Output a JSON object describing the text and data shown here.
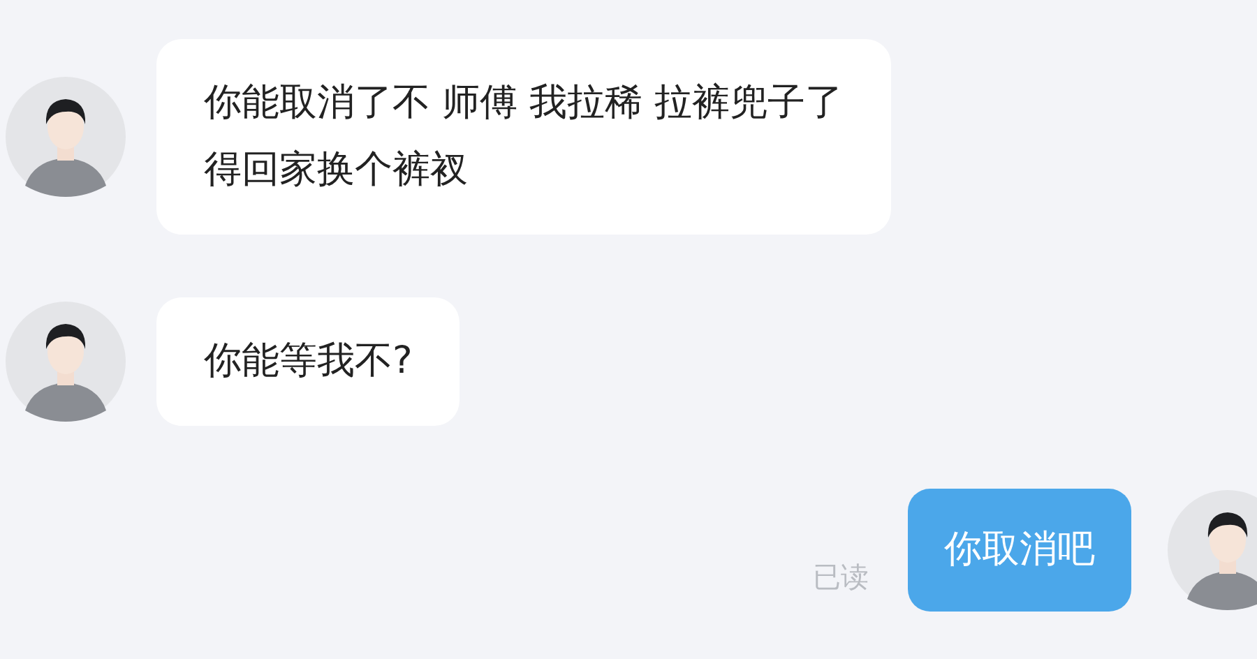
{
  "messages": [
    {
      "kind": "received",
      "lines": [
        "你能取消了不 师傅 我拉稀 拉裤兜子了",
        "得回家换个裤衩"
      ]
    },
    {
      "kind": "received",
      "lines": [
        "你能等我不?"
      ]
    },
    {
      "kind": "sent",
      "lines": [
        "你取消吧"
      ],
      "status": "已读"
    }
  ]
}
